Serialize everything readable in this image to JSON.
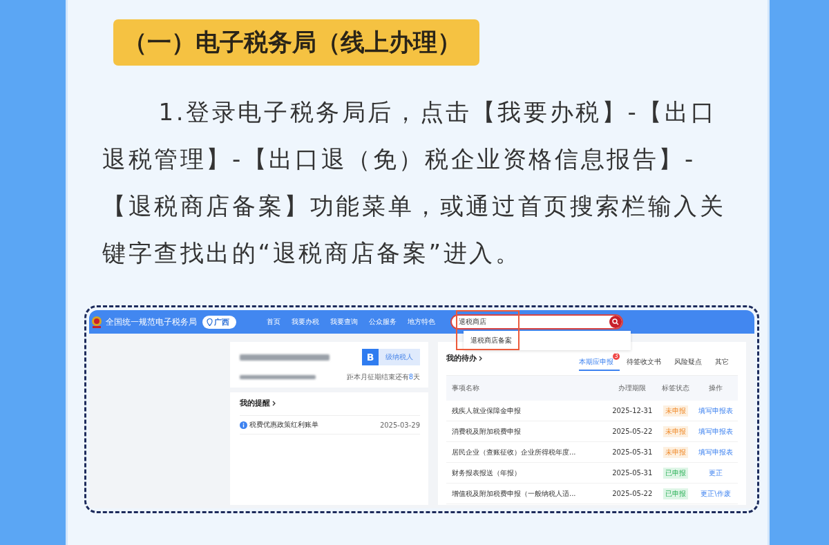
{
  "heading": "（一）电子税务局（线上办理）",
  "paragraph": "1.登录电子税务局后，点击【我要办税】-【出口退税管理】-【出口退（免）税企业资格信息报告】-【退税商店备案】功能菜单，或通过首页搜索栏输入关键字查找出的“退税商店备案”进入。",
  "screenshot": {
    "site_title": "全国统一规范电子税务局",
    "region": "广西",
    "nav": [
      "首页",
      "我要办税",
      "我要查询",
      "公众服务",
      "地方特色"
    ],
    "search": {
      "value": "退税商店"
    },
    "suggestions": [
      "退税商店备案"
    ],
    "taxpayer": {
      "grade": "B",
      "grade_label": "级纳税人",
      "deadline": "距本月征期结束还有**8**天"
    },
    "reminders": {
      "title": "我的提醒",
      "items": [
        {
          "text": "税费优惠政策红利账单",
          "date": "2025-03-29"
        }
      ]
    },
    "todo": {
      "title": "我的待办",
      "tabs": [
        {
          "label": "本期应申报",
          "selected": true,
          "badge": "3"
        },
        {
          "label": "待签收文书",
          "selected": false
        },
        {
          "label": "风险疑点",
          "selected": false
        },
        {
          "label": "其它",
          "selected": false
        }
      ],
      "columns": [
        "事项名称",
        "办理期限",
        "标签状态",
        "操作"
      ],
      "rows": [
        {
          "name": "残疾人就业保障金申报",
          "deadline": "2025-12-31",
          "status": "未申报",
          "kind": "pending",
          "action": "填写申报表"
        },
        {
          "name": "消费税及附加税费申报",
          "deadline": "2025-05-22",
          "status": "未申报",
          "kind": "pending",
          "action": "填写申报表"
        },
        {
          "name": "居民企业（查账征收）企业所得税年度...",
          "deadline": "2025-05-31",
          "status": "未申报",
          "kind": "pending",
          "action": "填写申报表"
        },
        {
          "name": "财务报表报送（年报）",
          "deadline": "2025-05-31",
          "status": "已申报",
          "kind": "done",
          "action": "更正"
        },
        {
          "name": "增值税及附加税费申报（一般纳税人适...",
          "deadline": "2025-05-22",
          "status": "已申报",
          "kind": "done",
          "action": "更正\\作废"
        }
      ]
    }
  }
}
